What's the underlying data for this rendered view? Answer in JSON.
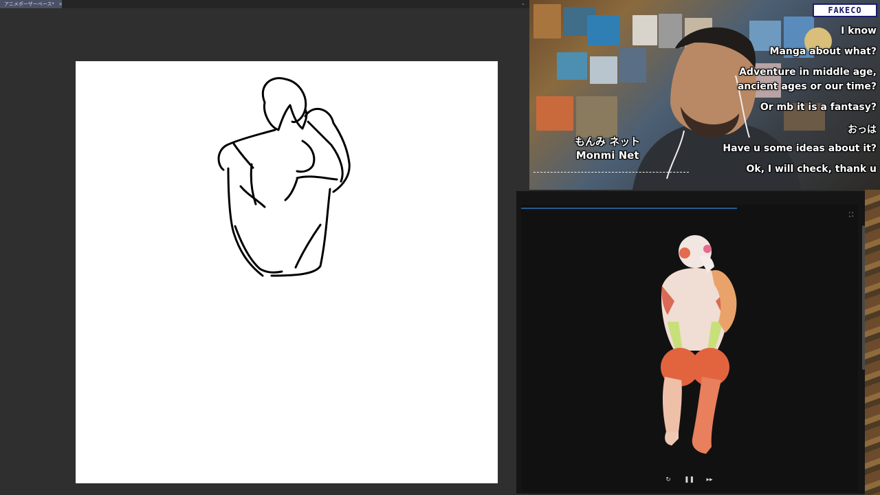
{
  "drawing_app": {
    "tab_title": "アニメポーザーベース*",
    "tab_close": "×",
    "tab_menu_arrow": "⌄"
  },
  "stream_overlay": {
    "brand_logo": "FAKECO",
    "channel_name_jp": "もんみ ネット",
    "channel_name_en": "Monmi Net",
    "chat": [
      "I know",
      "Manga about what?",
      "Adventure in middle age,",
      "ancient ages or our time?",
      "Or mb it is a fantasy?",
      "おっは",
      "Have u some ideas about it?",
      "Ok, I will check, thank u"
    ]
  },
  "viewer": {
    "fullscreen_icon": "⛶",
    "controls": {
      "replay": "↻",
      "pause": "❚❚",
      "forward": "▸▸"
    },
    "progress": 0.64
  },
  "colors": {
    "app_bg": "#2f2f2f",
    "canvas_bg": "#ffffff",
    "tab_active": "#4a5066",
    "viewer_bg": "#151515",
    "progress": "#2a5b8e",
    "brand_blue": "#1b1b6a"
  }
}
